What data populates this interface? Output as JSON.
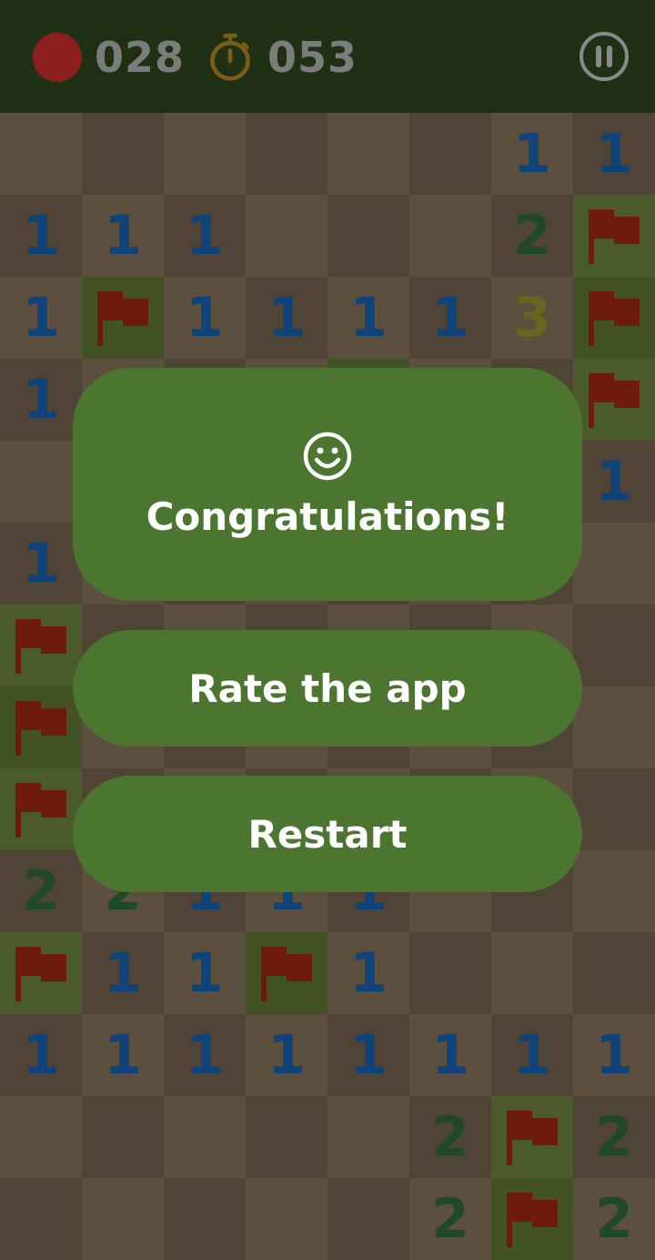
{
  "header": {
    "mine_counter": "028",
    "timer": "053",
    "mine_icon": "red-circle-icon",
    "timer_icon": "stopwatch-icon",
    "pause_icon": "pause-icon"
  },
  "board": {
    "rows": [
      [
        "",
        "",
        "",
        "",
        "",
        "",
        "1",
        "1"
      ],
      [
        "1",
        "1",
        "1",
        "",
        "",
        "",
        "2",
        "F"
      ],
      [
        "1",
        "F",
        "1",
        "1",
        "1",
        "1",
        "3",
        "F"
      ],
      [
        "1",
        "",
        "",
        "",
        "",
        "",
        "",
        "F"
      ],
      [
        "",
        "",
        "",
        "",
        "",
        "",
        "",
        "1"
      ],
      [
        "1",
        "",
        "",
        "",
        "",
        "",
        "",
        ""
      ],
      [
        "F",
        "",
        "",
        "",
        "",
        "",
        "",
        ""
      ],
      [
        "F",
        "",
        "",
        "",
        "",
        "",
        "",
        ""
      ],
      [
        "F",
        "",
        "",
        "",
        "",
        "",
        "",
        ""
      ],
      [
        "2",
        "2",
        "1",
        "1",
        "1",
        "",
        "",
        ""
      ],
      [
        "F",
        "1",
        "1",
        "F",
        "1",
        "",
        "",
        ""
      ],
      [
        "1",
        "1",
        "1",
        "1",
        "1",
        "1",
        "1",
        "1"
      ],
      [
        "",
        "",
        "",
        "",
        "",
        "2",
        "F",
        "2"
      ],
      [
        "",
        "",
        "",
        "",
        "",
        "2",
        "F",
        "2"
      ]
    ],
    "unrevealed": [
      [
        3,
        4
      ]
    ]
  },
  "dialog": {
    "icon": "smiley-icon",
    "title": "Congratulations!",
    "rate_label": "Rate the app",
    "restart_label": "Restart"
  },
  "colors": {
    "topbar": "#203015",
    "mine_icon": "#8b1f1f",
    "timer_icon": "#7a5e17",
    "pause_icon": "#8a8a8a",
    "cell_light": "#5c4f40",
    "cell_dark": "#4f4436",
    "flag_cell_light": "#4b5a2a",
    "flag_cell_dark": "#435224",
    "flag": "#6e1a0c",
    "number_1": "#10437a",
    "number_2": "#1f4a25",
    "number_3": "#6b6420",
    "panel": "#4c7530",
    "panel_text": "#ffffff"
  }
}
